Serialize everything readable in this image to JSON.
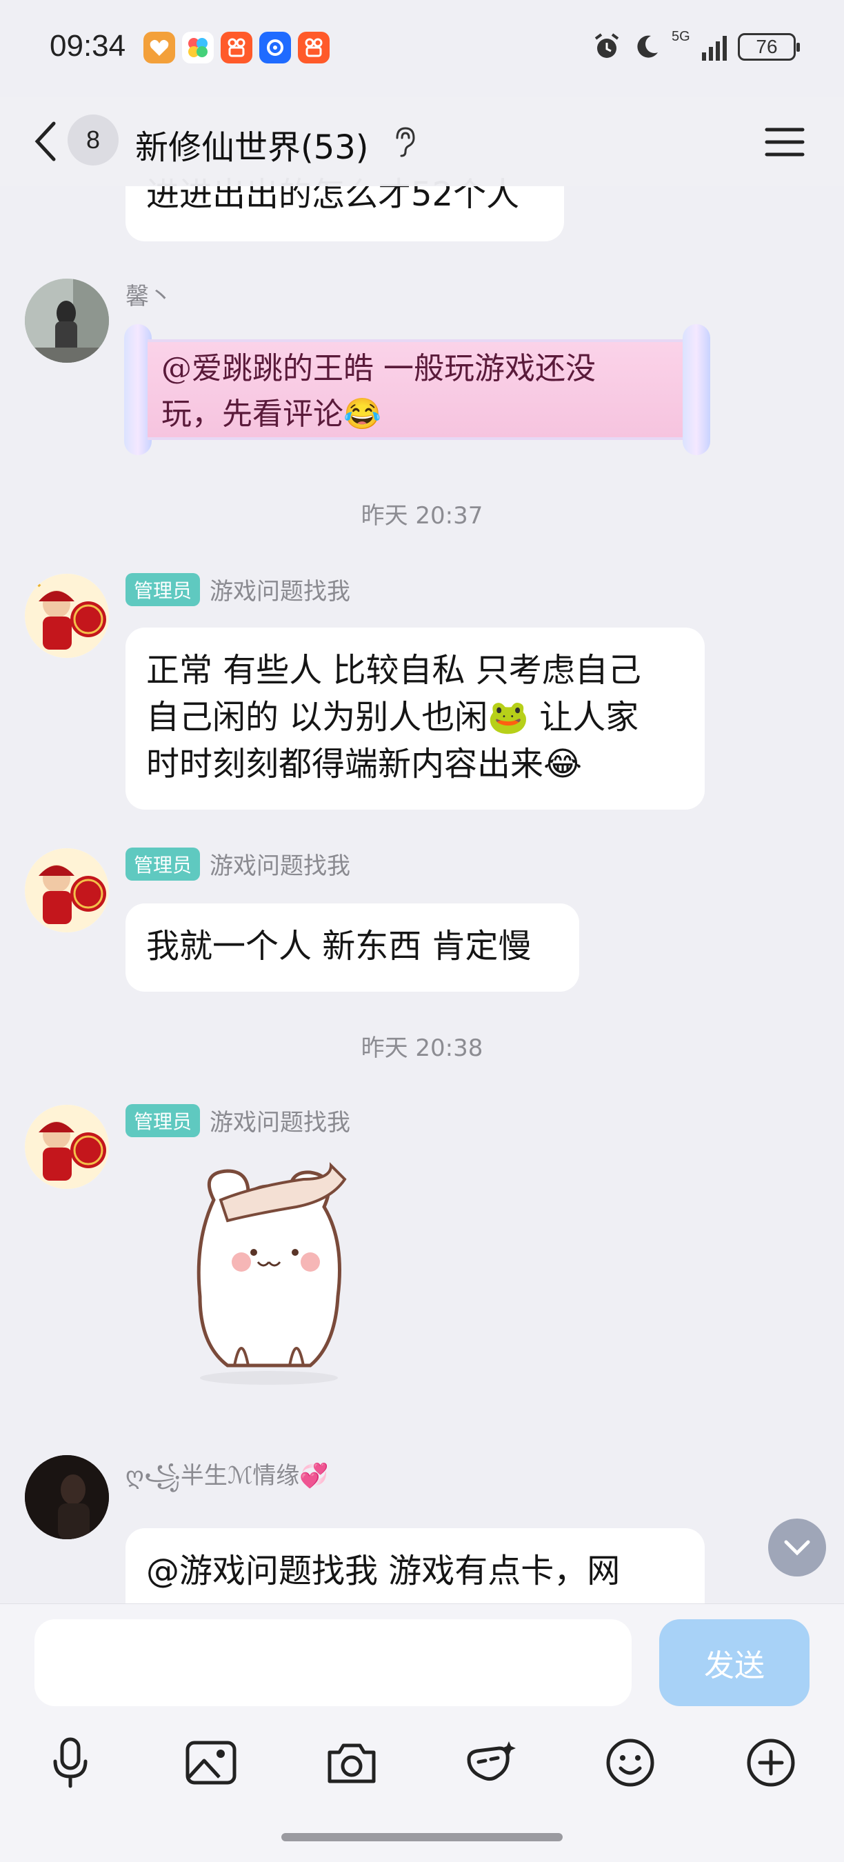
{
  "status_bar": {
    "time": "09:34",
    "network": "5G",
    "battery": "76"
  },
  "header": {
    "unread_count": "8",
    "title": "新修仙世界(53)"
  },
  "messages": {
    "partial_top": {
      "text": "进进出出的怎么才52个人"
    },
    "msg1": {
      "sender": "馨丶",
      "text_line1": "@爱跳跳的王皓 一般玩游戏还没",
      "text_line2": "玩，先看评论😂"
    },
    "time1": "昨天 20:37",
    "msg2": {
      "tag": "管理员",
      "sender": "游戏问题找我",
      "line1": "正常 有些人 比较自私 只考虑自己",
      "line2": "自己闲的 以为别人也闲🐸  让人家",
      "line3": "时时刻刻都得端新内容出来😂"
    },
    "msg3": {
      "tag": "管理员",
      "sender": "游戏问题找我",
      "text": "我就一个人 新东西 肯定慢"
    },
    "time2": "昨天 20:38",
    "msg4": {
      "tag": "管理员",
      "sender": "游戏问题找我"
    },
    "msg5": {
      "sender": "ღ꧁半生ℳ情缘💞",
      "line1": "@游戏问题找我 游戏有点卡，网"
    }
  },
  "input": {
    "placeholder": "",
    "send_label": "发送"
  },
  "colors": {
    "admin_tag": "#5fc9c0",
    "send_button": "#a8d2f7",
    "background": "#efeff4"
  },
  "toolbar_icons": [
    "microphone-icon",
    "image-icon",
    "camera-icon",
    "magic-icon",
    "emoji-icon",
    "plus-icon"
  ]
}
